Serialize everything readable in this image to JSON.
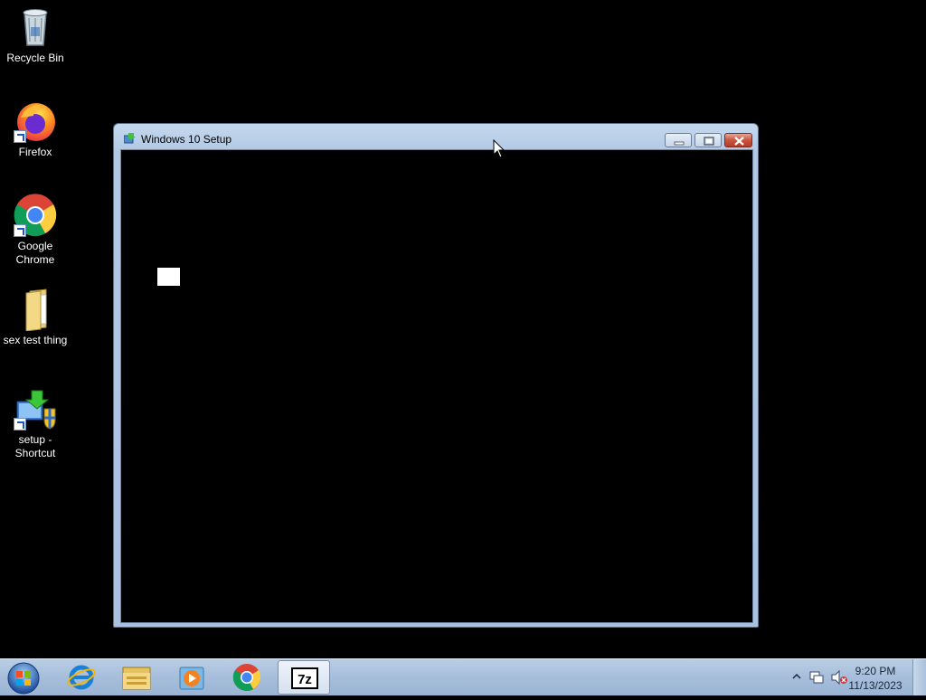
{
  "desktop": {
    "icons": [
      {
        "label": "Recycle Bin",
        "icon": "recycle-bin-icon"
      },
      {
        "label": "Firefox",
        "icon": "firefox-icon"
      },
      {
        "label": "Google Chrome",
        "icon": "chrome-icon"
      },
      {
        "label": "sex test thing",
        "icon": "folder-icon"
      },
      {
        "label": "setup - Shortcut",
        "icon": "setup-icon"
      }
    ]
  },
  "window": {
    "title": "Windows 10 Setup",
    "buttons": {
      "minimize": "minimize-icon",
      "maximize": "maximize-icon",
      "close": "close-icon"
    },
    "client_background": "#000000"
  },
  "taskbar": {
    "start": "windows-start-icon",
    "items": [
      {
        "name": "internet-explorer-icon"
      },
      {
        "name": "file-explorer-icon"
      },
      {
        "name": "media-player-icon"
      },
      {
        "name": "chrome-icon"
      },
      {
        "name": "7zip-icon",
        "label": "7z",
        "active": true
      }
    ],
    "tray": {
      "time": "9:20 PM",
      "date": "11/13/2023",
      "icons": [
        "show-hidden-icons-chevron",
        "network-icon",
        "volume-muted-icon"
      ]
    }
  }
}
